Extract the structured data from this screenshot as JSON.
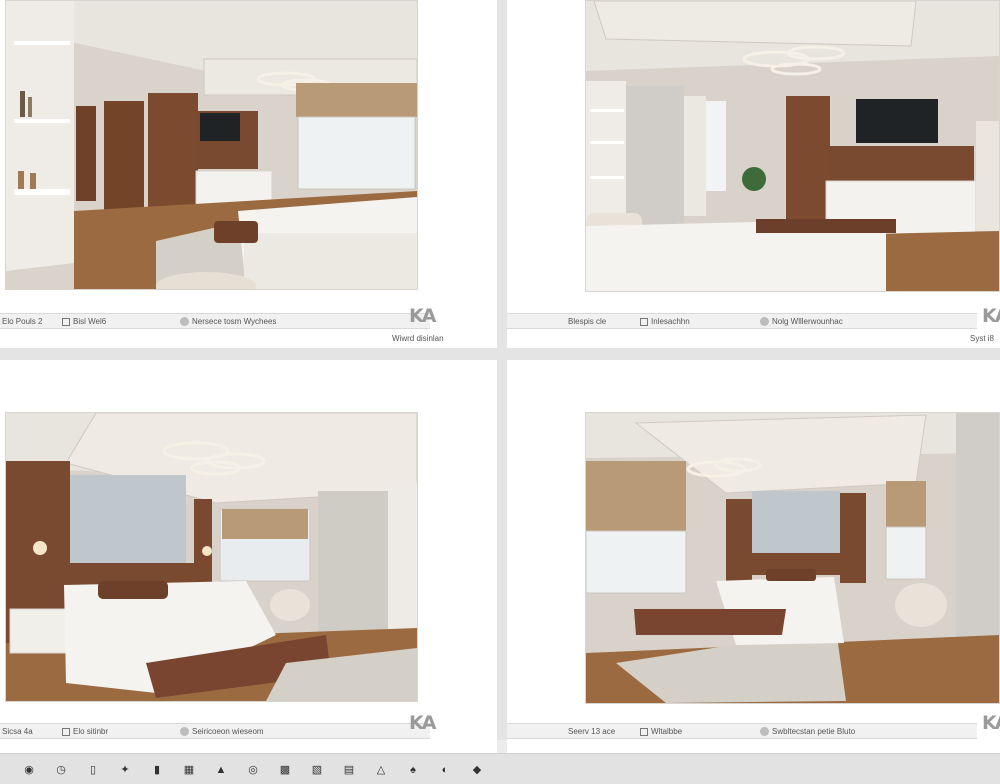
{
  "panels": [
    {
      "chip_a": "Elo Pouls 2",
      "chip_b": "Bisl Wel6",
      "chip_c": "Nersece tosm Wychees",
      "caption": "Wiwrd disinlan",
      "logo": "KA"
    },
    {
      "chip_a": "Blespis cle",
      "chip_b": "Inlesachhn",
      "chip_c": "Nolg Wlllerwounhac",
      "caption": "Syst i8",
      "logo": "KA"
    },
    {
      "chip_a": "Sicsa 4a",
      "chip_b": "Elo sitinbr",
      "chip_c": "Seiricoeon wieseom",
      "caption": "",
      "logo": "KA"
    },
    {
      "chip_a": "Seerv 13 ace",
      "chip_b": "Wltalbbe",
      "chip_c": "Swbltecstan petie Bluto",
      "caption": "",
      "logo": "KA"
    }
  ],
  "taskbar": {
    "icons": [
      "camera-icon",
      "clock-icon",
      "phone-icon",
      "magic-wand-icon",
      "document-icon",
      "image-icon",
      "warning-icon",
      "target-icon",
      "monitor-icon",
      "display-icon",
      "text-box-icon",
      "alert-icon",
      "spade-icon",
      "color-icon",
      "drop-icon"
    ]
  },
  "colors": {
    "wood": "#7a4a30",
    "wall": "#d8d2ca",
    "floor": "#9c6a41",
    "shade": "#b89a77"
  }
}
